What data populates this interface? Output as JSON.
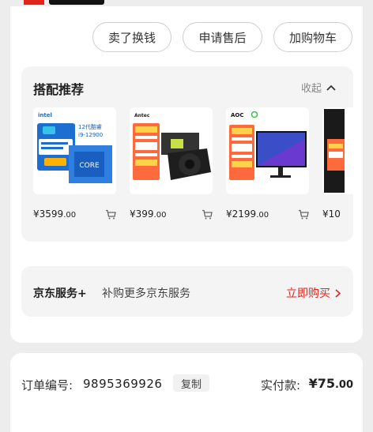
{
  "actions": {
    "sell_label": "卖了换钱",
    "after_sale_label": "申请售后",
    "add_cart_label": "加购物车"
  },
  "recommend": {
    "title": "搭配推荐",
    "collapse_label": "收起",
    "products": [
      {
        "name": "Intel Core i9-12900",
        "img_caption": "12代酷睿",
        "img_model": "i9-12900",
        "brand": "intel",
        "price_int": "¥3599",
        "price_dec": ".00"
      },
      {
        "name": "Antec power supply",
        "brand": "Antec",
        "price_int": "¥399",
        "price_dec": ".00"
      },
      {
        "name": "AOC monitor",
        "brand": "AOC",
        "price_int": "¥2199",
        "price_dec": ".00"
      },
      {
        "name": "partial product",
        "brand": "",
        "price_int": "¥10",
        "price_dec": ""
      }
    ]
  },
  "service": {
    "title": "京东服务+",
    "desc": "补购更多京东服务",
    "buy_label": "立即购买"
  },
  "order": {
    "number_label": "订单编号:",
    "number": "9895369926",
    "copy_label": "复制",
    "paid_label": "实付款:",
    "paid_int": "¥75",
    "paid_dec": ".00"
  },
  "colors": {
    "accent": "#e1251b",
    "page_bg": "#ededed",
    "panel_bg": "#f4f4f4"
  }
}
